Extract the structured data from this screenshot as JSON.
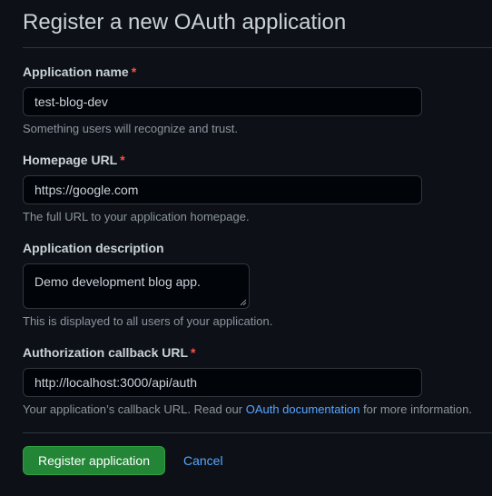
{
  "page": {
    "title": "Register a new OAuth application"
  },
  "form": {
    "app_name": {
      "label": "Application name",
      "required_mark": "*",
      "value": "test-blog-dev",
      "note": "Something users will recognize and trust."
    },
    "homepage_url": {
      "label": "Homepage URL",
      "required_mark": "*",
      "value": "https://google.com",
      "note": "The full URL to your application homepage."
    },
    "description": {
      "label": "Application description",
      "value": "Demo development blog app.",
      "note": "This is displayed to all users of your application."
    },
    "callback_url": {
      "label": "Authorization callback URL",
      "required_mark": "*",
      "value": "http://localhost:3000/api/auth",
      "note_prefix": "Your application’s callback URL. Read our ",
      "note_link": "OAuth documentation",
      "note_suffix": " for more information."
    }
  },
  "actions": {
    "register_label": "Register application",
    "cancel_label": "Cancel"
  },
  "colors": {
    "background": "#0d1117",
    "primary_button": "#238636",
    "link": "#58a6ff",
    "required": "#f85149"
  }
}
